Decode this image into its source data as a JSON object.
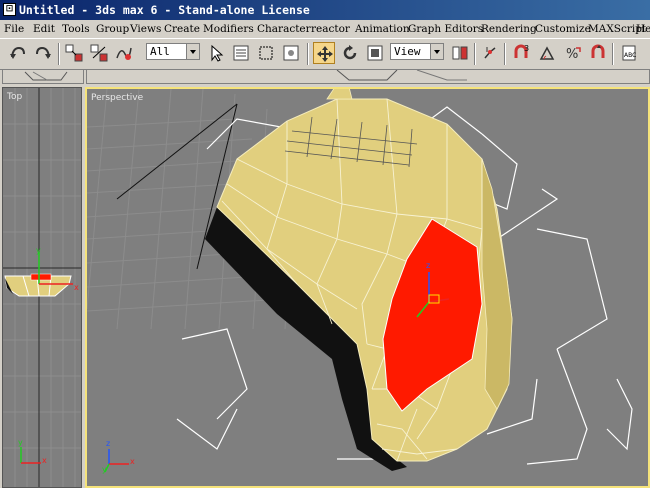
{
  "window": {
    "title": "Untitled - 3ds max 6 - Stand-alone License",
    "app_icon": "3ds-max-logo"
  },
  "menu": {
    "items": [
      "File",
      "Edit",
      "Tools",
      "Group",
      "Views",
      "Create",
      "Modifiers",
      "Character",
      "reactor",
      "Animation",
      "Graph Editors",
      "Rendering",
      "Customize",
      "MAXScript",
      "He"
    ]
  },
  "toolbar": {
    "selection_filter": "All",
    "reference_coord": "View",
    "icons": [
      "undo-icon",
      "redo-icon",
      "select-and-link-icon",
      "unlink-icon",
      "bind-to-space-warp-icon",
      "select-object-icon",
      "select-by-name-icon",
      "rectangular-selection-icon",
      "window-crossing-icon",
      "select-and-move-icon",
      "select-and-rotate-icon",
      "select-and-scale-icon",
      "use-pivot-center-icon",
      "select-and-manipulate-icon",
      "snaps-toggle-icon",
      "angle-snap-icon",
      "percent-snap-icon",
      "spinner-snap-icon",
      "edit-named-selection-icon"
    ],
    "active_tool": "select-and-move-icon"
  },
  "viewports": {
    "top": {
      "label": "Top"
    },
    "perspective": {
      "label": "Perspective"
    },
    "active_border": "#f5e37a",
    "background": "#7f7f7f"
  },
  "axis": {
    "x": "x",
    "y": "y",
    "z": "z"
  },
  "colors": {
    "model": "#e1cf7e",
    "selection": "#ff1a00",
    "titlebar": "#0a246a"
  }
}
